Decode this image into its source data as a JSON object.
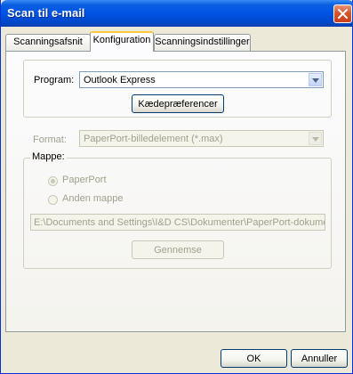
{
  "window": {
    "title": "Scan til e-mail",
    "close_icon": "close-icon"
  },
  "tabs": [
    {
      "label": "Scanningsafsnit",
      "active": false
    },
    {
      "label": "Konfiguration",
      "active": true
    },
    {
      "label": "Scanningsindstillinger",
      "active": false
    }
  ],
  "program": {
    "label": "Program:",
    "value": "Outlook Express",
    "prefs_button": "Kædepræferencer"
  },
  "format": {
    "label": "Format:",
    "value": "PaperPort-billedelement (*.max)"
  },
  "folder": {
    "legend": "Mappe:",
    "option_paperport": "PaperPort",
    "option_other": "Anden mappe",
    "path": "E:\\Documents and Settings\\I&D CS\\Dokumenter\\PaperPort-dokument",
    "browse_button": "Gennemse"
  },
  "footer": {
    "ok": "OK",
    "cancel": "Annuller"
  },
  "colors": {
    "titlebar": "#0054e3",
    "window_bg": "#ece9d8",
    "tab_highlight": "#ffc83c"
  }
}
